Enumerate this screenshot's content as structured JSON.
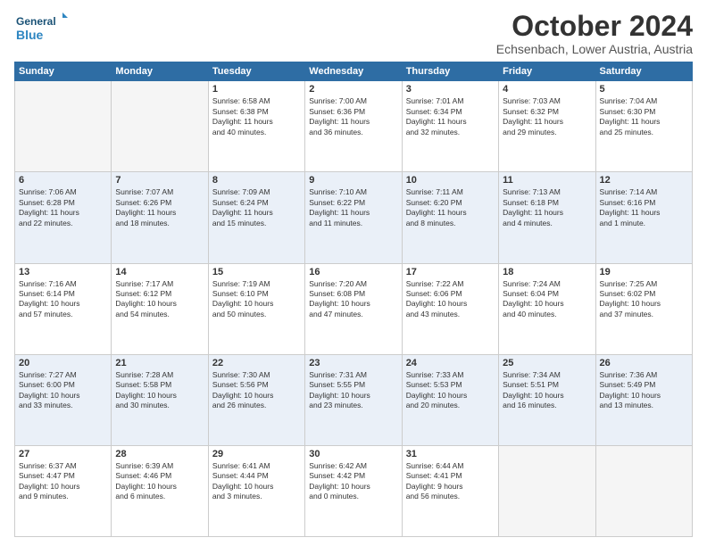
{
  "header": {
    "logo_line1": "General",
    "logo_line2": "Blue",
    "month": "October 2024",
    "location": "Echsenbach, Lower Austria, Austria"
  },
  "weekdays": [
    "Sunday",
    "Monday",
    "Tuesday",
    "Wednesday",
    "Thursday",
    "Friday",
    "Saturday"
  ],
  "weeks": [
    [
      {
        "day": "",
        "info": ""
      },
      {
        "day": "",
        "info": ""
      },
      {
        "day": "1",
        "info": "Sunrise: 6:58 AM\nSunset: 6:38 PM\nDaylight: 11 hours\nand 40 minutes."
      },
      {
        "day": "2",
        "info": "Sunrise: 7:00 AM\nSunset: 6:36 PM\nDaylight: 11 hours\nand 36 minutes."
      },
      {
        "day": "3",
        "info": "Sunrise: 7:01 AM\nSunset: 6:34 PM\nDaylight: 11 hours\nand 32 minutes."
      },
      {
        "day": "4",
        "info": "Sunrise: 7:03 AM\nSunset: 6:32 PM\nDaylight: 11 hours\nand 29 minutes."
      },
      {
        "day": "5",
        "info": "Sunrise: 7:04 AM\nSunset: 6:30 PM\nDaylight: 11 hours\nand 25 minutes."
      }
    ],
    [
      {
        "day": "6",
        "info": "Sunrise: 7:06 AM\nSunset: 6:28 PM\nDaylight: 11 hours\nand 22 minutes."
      },
      {
        "day": "7",
        "info": "Sunrise: 7:07 AM\nSunset: 6:26 PM\nDaylight: 11 hours\nand 18 minutes."
      },
      {
        "day": "8",
        "info": "Sunrise: 7:09 AM\nSunset: 6:24 PM\nDaylight: 11 hours\nand 15 minutes."
      },
      {
        "day": "9",
        "info": "Sunrise: 7:10 AM\nSunset: 6:22 PM\nDaylight: 11 hours\nand 11 minutes."
      },
      {
        "day": "10",
        "info": "Sunrise: 7:11 AM\nSunset: 6:20 PM\nDaylight: 11 hours\nand 8 minutes."
      },
      {
        "day": "11",
        "info": "Sunrise: 7:13 AM\nSunset: 6:18 PM\nDaylight: 11 hours\nand 4 minutes."
      },
      {
        "day": "12",
        "info": "Sunrise: 7:14 AM\nSunset: 6:16 PM\nDaylight: 11 hours\nand 1 minute."
      }
    ],
    [
      {
        "day": "13",
        "info": "Sunrise: 7:16 AM\nSunset: 6:14 PM\nDaylight: 10 hours\nand 57 minutes."
      },
      {
        "day": "14",
        "info": "Sunrise: 7:17 AM\nSunset: 6:12 PM\nDaylight: 10 hours\nand 54 minutes."
      },
      {
        "day": "15",
        "info": "Sunrise: 7:19 AM\nSunset: 6:10 PM\nDaylight: 10 hours\nand 50 minutes."
      },
      {
        "day": "16",
        "info": "Sunrise: 7:20 AM\nSunset: 6:08 PM\nDaylight: 10 hours\nand 47 minutes."
      },
      {
        "day": "17",
        "info": "Sunrise: 7:22 AM\nSunset: 6:06 PM\nDaylight: 10 hours\nand 43 minutes."
      },
      {
        "day": "18",
        "info": "Sunrise: 7:24 AM\nSunset: 6:04 PM\nDaylight: 10 hours\nand 40 minutes."
      },
      {
        "day": "19",
        "info": "Sunrise: 7:25 AM\nSunset: 6:02 PM\nDaylight: 10 hours\nand 37 minutes."
      }
    ],
    [
      {
        "day": "20",
        "info": "Sunrise: 7:27 AM\nSunset: 6:00 PM\nDaylight: 10 hours\nand 33 minutes."
      },
      {
        "day": "21",
        "info": "Sunrise: 7:28 AM\nSunset: 5:58 PM\nDaylight: 10 hours\nand 30 minutes."
      },
      {
        "day": "22",
        "info": "Sunrise: 7:30 AM\nSunset: 5:56 PM\nDaylight: 10 hours\nand 26 minutes."
      },
      {
        "day": "23",
        "info": "Sunrise: 7:31 AM\nSunset: 5:55 PM\nDaylight: 10 hours\nand 23 minutes."
      },
      {
        "day": "24",
        "info": "Sunrise: 7:33 AM\nSunset: 5:53 PM\nDaylight: 10 hours\nand 20 minutes."
      },
      {
        "day": "25",
        "info": "Sunrise: 7:34 AM\nSunset: 5:51 PM\nDaylight: 10 hours\nand 16 minutes."
      },
      {
        "day": "26",
        "info": "Sunrise: 7:36 AM\nSunset: 5:49 PM\nDaylight: 10 hours\nand 13 minutes."
      }
    ],
    [
      {
        "day": "27",
        "info": "Sunrise: 6:37 AM\nSunset: 4:47 PM\nDaylight: 10 hours\nand 9 minutes."
      },
      {
        "day": "28",
        "info": "Sunrise: 6:39 AM\nSunset: 4:46 PM\nDaylight: 10 hours\nand 6 minutes."
      },
      {
        "day": "29",
        "info": "Sunrise: 6:41 AM\nSunset: 4:44 PM\nDaylight: 10 hours\nand 3 minutes."
      },
      {
        "day": "30",
        "info": "Sunrise: 6:42 AM\nSunset: 4:42 PM\nDaylight: 10 hours\nand 0 minutes."
      },
      {
        "day": "31",
        "info": "Sunrise: 6:44 AM\nSunset: 4:41 PM\nDaylight: 9 hours\nand 56 minutes."
      },
      {
        "day": "",
        "info": ""
      },
      {
        "day": "",
        "info": ""
      }
    ]
  ]
}
